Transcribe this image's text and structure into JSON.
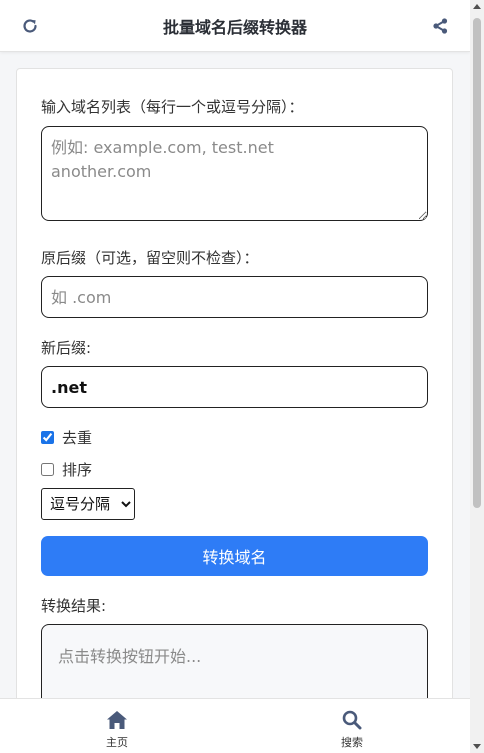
{
  "header": {
    "title": "批量域名后缀转换器",
    "refresh_icon": "refresh-icon",
    "share_icon": "share-icon"
  },
  "form": {
    "domains_label": "输入域名列表（每行一个或逗号分隔）：",
    "domains_placeholder": "例如: example.com, test.net\nanother.com",
    "domains_value": "",
    "old_suffix_label": "原后缀（可选，留空则不检查）：",
    "old_suffix_placeholder": "如 .com",
    "old_suffix_value": "",
    "new_suffix_label": "新后缀:",
    "new_suffix_value": ".net",
    "dedupe_label": "去重",
    "dedupe_checked": true,
    "sort_label": "排序",
    "sort_checked": false,
    "separator_selected": "逗号分隔",
    "convert_button": "转换域名",
    "result_label": "转换结果:",
    "result_placeholder": "点击转换按钮开始..."
  },
  "bottom_nav": {
    "home_label": "主页",
    "home_icon": "home-icon",
    "search_label": "搜索",
    "search_icon": "search-icon"
  },
  "colors": {
    "accent": "#2e7cf6",
    "nav_icon": "#4a5a7a"
  }
}
